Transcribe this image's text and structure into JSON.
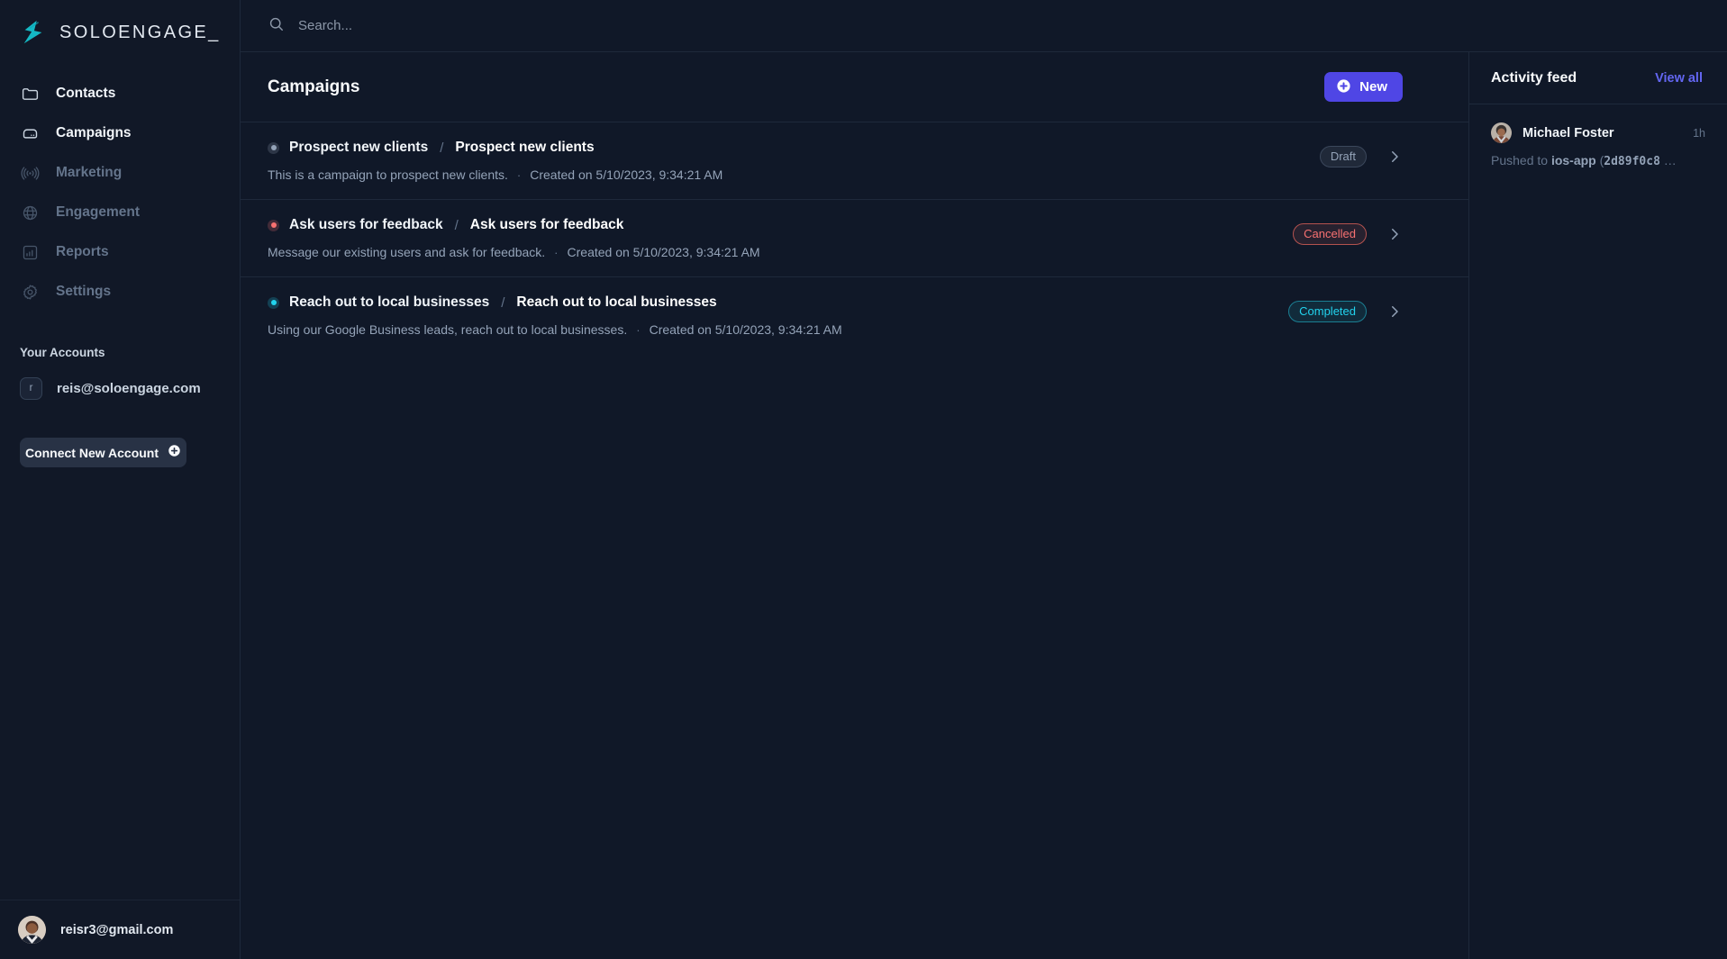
{
  "brand": {
    "name": "SOLOENGAGE_",
    "logo_icon": "soloengage-logo-icon",
    "accent": "#14b8c4"
  },
  "sidebar": {
    "nav": [
      {
        "label": "Contacts",
        "icon": "folder-icon",
        "state": "active"
      },
      {
        "label": "Campaigns",
        "icon": "server-icon",
        "state": "active"
      },
      {
        "label": "Marketing",
        "icon": "broadcast-icon",
        "state": "dim"
      },
      {
        "label": "Engagement",
        "icon": "globe-icon",
        "state": "dim"
      },
      {
        "label": "Reports",
        "icon": "bar-chart-icon",
        "state": "dim"
      },
      {
        "label": "Settings",
        "icon": "gear-icon",
        "state": "dim"
      }
    ],
    "accounts_title": "Your Accounts",
    "accounts": [
      {
        "initial": "r",
        "email": "reis@soloengage.com"
      }
    ],
    "connect_button": {
      "label": "Connect New Account",
      "icon": "plus-circle-icon"
    },
    "profile": {
      "email": "reisr3@gmail.com",
      "avatar": "user-avatar"
    }
  },
  "topbar": {
    "search": {
      "placeholder": "Search...",
      "value": "",
      "icon": "search-icon"
    }
  },
  "page": {
    "title": "Campaigns",
    "new_button": {
      "label": "New",
      "icon": "plus-circle-icon",
      "color": "#4f46e5"
    }
  },
  "campaigns": [
    {
      "owner": "Prospect new clients",
      "separator": "/",
      "name": "Prospect new clients",
      "description": "This is a campaign to prospect new clients.",
      "meta_dot": "·",
      "created": "Created on 5/10/2023, 9:34:21 AM",
      "status": "Draft",
      "status_color": "#94a3b8",
      "status_bg": "rgba(148,163,184,0.12)",
      "dot_color": "#94a3b8",
      "dot_ring": "rgba(148,163,184,0.22)",
      "chevron_icon": "chevron-right-icon"
    },
    {
      "owner": "Ask users for feedback",
      "separator": "/",
      "name": "Ask users for feedback",
      "description": "Message our existing users and ask for feedback.",
      "meta_dot": "·",
      "created": "Created on 5/10/2023, 9:34:21 AM",
      "status": "Cancelled",
      "status_color": "#f87171",
      "status_bg": "rgba(248,113,113,0.10)",
      "dot_color": "#f87171",
      "dot_ring": "rgba(248,113,113,0.22)",
      "chevron_icon": "chevron-right-icon"
    },
    {
      "owner": "Reach out to local businesses",
      "separator": "/",
      "name": "Reach out to local businesses",
      "description": "Using our Google Business leads, reach out to local businesses.",
      "meta_dot": "·",
      "created": "Created on 5/10/2023, 9:34:21 AM",
      "status": "Completed",
      "status_color": "#22d3ee",
      "status_bg": "rgba(34,211,238,0.10)",
      "dot_color": "#22d3ee",
      "dot_ring": "rgba(34,211,238,0.22)",
      "chevron_icon": "chevron-right-icon"
    }
  ],
  "activity_feed": {
    "title": "Activity feed",
    "view_all": "View all",
    "items": [
      {
        "name": "Michael Foster",
        "time": "1h",
        "text_prefix": "Pushed to ",
        "target": "ios-app",
        "text_mid": " (",
        "hash": "2d89f0c8",
        "text_suffix": " …"
      }
    ]
  }
}
